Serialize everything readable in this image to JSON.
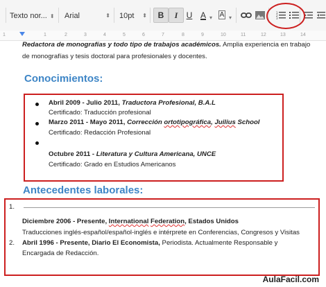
{
  "toolbar": {
    "style_select": "Texto nor...",
    "font_select": "Arial",
    "size_select": "10pt",
    "bold_label": "B",
    "italic_label": "I",
    "underline_label": "U",
    "text_color_label": "A",
    "highlight_label": "A"
  },
  "ruler": {
    "marks": [
      "1",
      "1",
      "2",
      "3",
      "4",
      "5",
      "6",
      "7",
      "8",
      "9",
      "10",
      "11",
      "12",
      "13",
      "14"
    ]
  },
  "doc": {
    "intro_line1_italic": "Redactora de monografías y todo tipo de trabajos académicos.",
    "intro_line1_rest": " Amplia experiencia en trabajo",
    "intro_line2": "de monografías y tesis doctoral para profesionales y docentes.",
    "heading_knowledge": "Conocimientos:",
    "k1_bold": "Abril 2009 - Julio 2011, ",
    "k1_italic": "Traductora Profesional, B.A.L",
    "k1_cert": "Certificado: Traducción profesional",
    "k2_bold": "Marzo 2011 - Mayo 2011, ",
    "k2_italic_a": "Corrección ",
    "k2_italic_spell": "ortotipográfica",
    "k2_italic_b": ", ",
    "k2_italic_spell2": "Juilius",
    "k2_italic_c": " School",
    "k2_cert": "Certificado: Redacción Profesional",
    "k3_bold": "Octubre 2011 - ",
    "k3_italic": "Literatura y Cultura Americana, UNCE",
    "k3_cert": "Certificado: Grado en Estudios Americanos",
    "heading_work": "Antecedentes laborales:",
    "w1_num": "1.",
    "w1_bold_a": "Diciembre 2006 - Presente, ",
    "w1_bold_spell": "International",
    "w1_bold_b": " ",
    "w1_bold_spell2": "Federation",
    "w1_bold_c": ", Estados Unidos",
    "w1_desc": "Traducciones inglés-español/español-inglés e intérprete en Conferencias, Congresos y Visitas",
    "w2_num": "2.",
    "w2_bold": "Abril 1996 - Presente, Diario El Economista,",
    "w2_rest": " Periodista. Actualmente Responsable y",
    "w2_line2": "Encargada de Redacción."
  },
  "watermark": "AulaFacil.com",
  "colors": {
    "heading": "#3d85c6",
    "highlight_box": "#cc1f1f",
    "spellcheck": "#e03030"
  }
}
